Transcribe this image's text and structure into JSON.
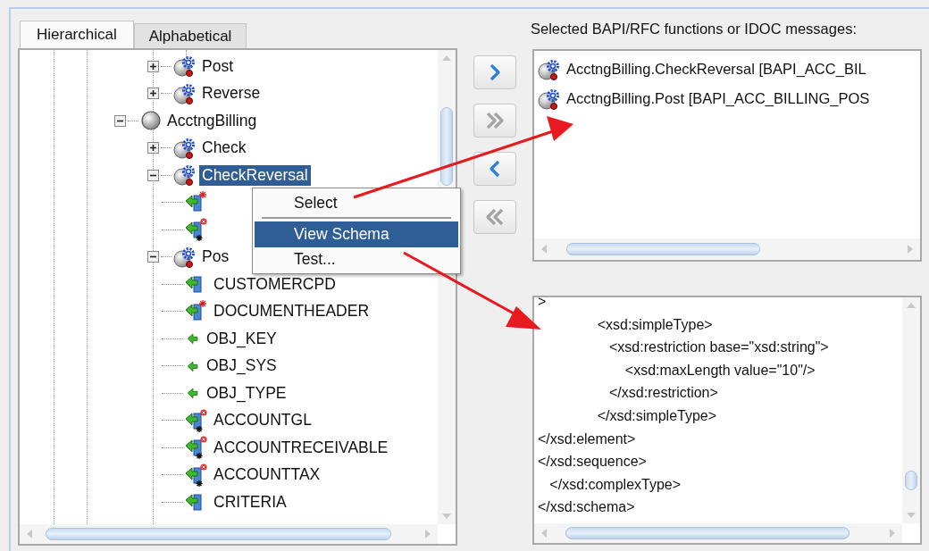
{
  "tabs": [
    {
      "label": "Hierarchical",
      "selected": true
    },
    {
      "label": "Alphabetical",
      "selected": false
    }
  ],
  "tree": {
    "items": [
      {
        "kind": "offscreen-parent",
        "children": [
          {
            "kind": "function",
            "label": "Post",
            "expanded": false,
            "selected": false
          },
          {
            "kind": "function",
            "label": "Reverse",
            "expanded": false,
            "selected": false
          }
        ]
      },
      {
        "kind": "group",
        "label": "AcctngBilling",
        "expanded": true,
        "selected": false,
        "children": [
          {
            "kind": "function",
            "label": "Check",
            "expanded": false,
            "selected": false
          },
          {
            "kind": "function",
            "label": "CheckReversal",
            "expanded": true,
            "selected": true,
            "children": [
              {
                "kind": "structure-required",
                "selected": false
              },
              {
                "kind": "table-out",
                "selected": false
              }
            ]
          },
          {
            "kind": "function",
            "label": "Pos",
            "expanded": true,
            "selected": false,
            "children": [
              {
                "kind": "structure",
                "label": "CUSTOMERCPD",
                "selected": false
              },
              {
                "kind": "structure-required",
                "label": "DOCUMENTHEADER",
                "selected": false
              },
              {
                "kind": "field",
                "label": "OBJ_KEY",
                "selected": false
              },
              {
                "kind": "field",
                "label": "OBJ_SYS",
                "selected": false
              },
              {
                "kind": "field",
                "label": "OBJ_TYPE",
                "selected": false
              },
              {
                "kind": "table",
                "label": "ACCOUNTGL",
                "selected": false
              },
              {
                "kind": "table",
                "label": "ACCOUNTRECEIVABLE",
                "selected": false
              },
              {
                "kind": "table",
                "label": "ACCOUNTTAX",
                "selected": false
              },
              {
                "kind": "structure",
                "label": "CRITERIA",
                "selected": false
              }
            ]
          }
        ]
      }
    ]
  },
  "context_menu": {
    "items": [
      {
        "kind": "item",
        "label": "Select",
        "selected": false
      },
      {
        "kind": "separator"
      },
      {
        "kind": "item",
        "label": "View Schema",
        "selected": true
      },
      {
        "kind": "item",
        "label": "Test...",
        "selected": false
      }
    ]
  },
  "transfer_buttons": [
    {
      "kind": "add",
      "disabled": false
    },
    {
      "kind": "add-all",
      "disabled": true
    },
    {
      "kind": "remove",
      "disabled": false
    },
    {
      "kind": "remove-all",
      "disabled": true
    }
  ],
  "selected_list": {
    "label": "Selected BAPI/RFC functions or IDOC messages:",
    "items": [
      {
        "label": "AcctngBilling.CheckReversal [BAPI_ACC_BIL",
        "selected": false
      },
      {
        "label": "AcctngBilling.Post [BAPI_ACC_BILLING_POS",
        "selected": false
      }
    ]
  },
  "schema": {
    "lines": [
      ">",
      "               <xsd:simpleType>",
      "                  <xsd:restriction base=\"xsd:string\">",
      "                      <xsd:maxLength value=\"10\"/>",
      "                  </xsd:restriction>",
      "               </xsd:simpleType>",
      "</xsd:element>",
      "</xsd:sequence>",
      "   </xsd:complexType>",
      "</xsd:schema>"
    ]
  }
}
